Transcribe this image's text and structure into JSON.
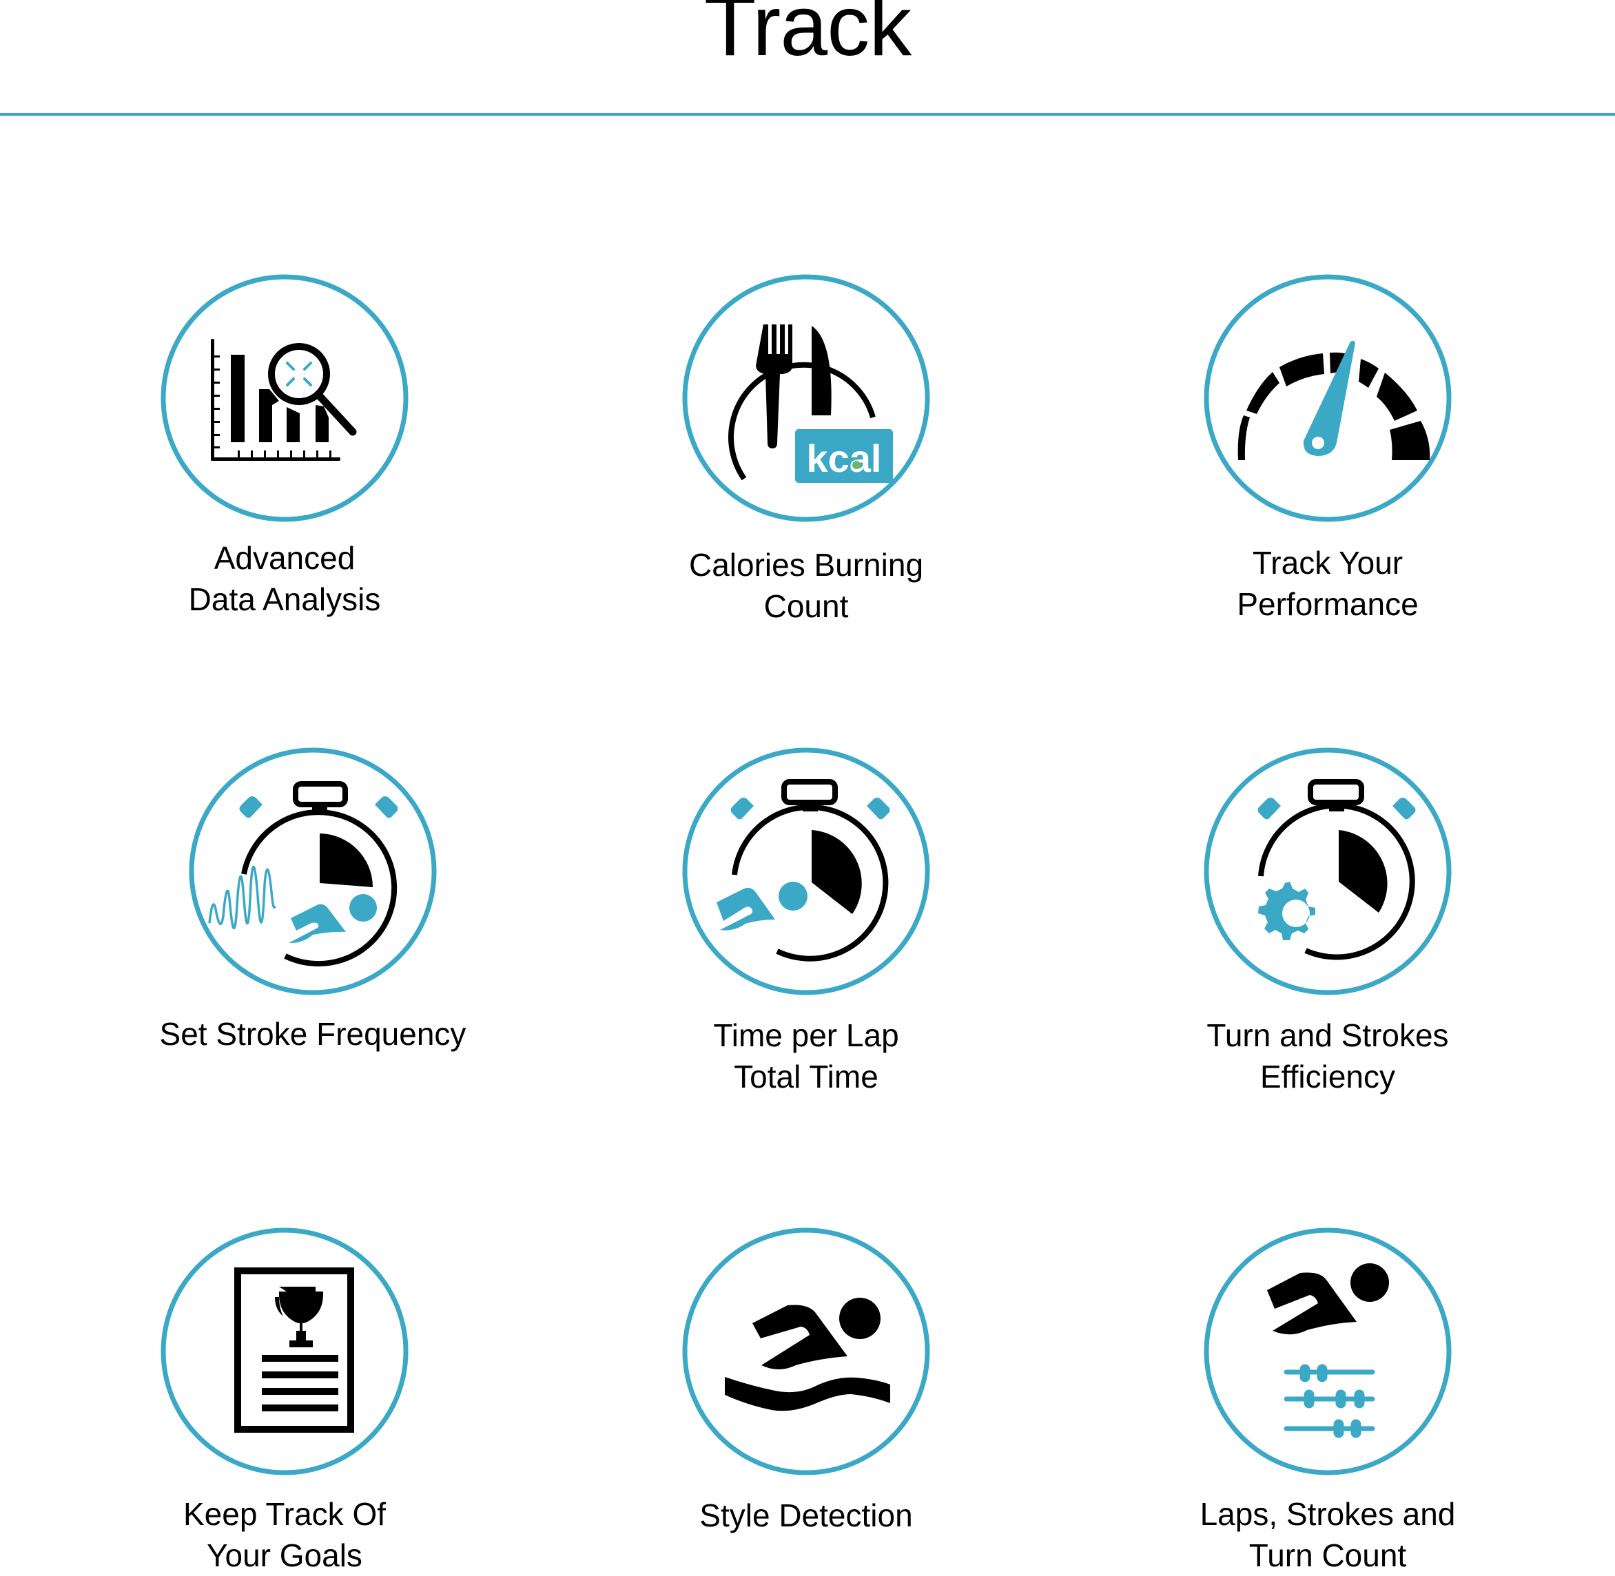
{
  "header": {
    "title": "Track"
  },
  "colors": {
    "accent": "#3ba8c5",
    "icon": "#000000",
    "kcal_dot": "#6cb86a"
  },
  "features": [
    {
      "icon": "data-analysis-icon",
      "label_lines": [
        "Advanced",
        "Data Analysis"
      ]
    },
    {
      "icon": "calories-icon",
      "badge": "kcal",
      "label_lines": [
        "Calories Burning",
        "Count"
      ]
    },
    {
      "icon": "speedometer-icon",
      "label_lines": [
        "Track Your",
        "Performance"
      ]
    },
    {
      "icon": "stroke-frequency-stopwatch-icon",
      "label_lines": [
        "Set Stroke Frequency"
      ]
    },
    {
      "icon": "lap-time-stopwatch-icon",
      "label_lines": [
        "Time per Lap",
        "Total Time"
      ]
    },
    {
      "icon": "efficiency-stopwatch-gear-icon",
      "label_lines": [
        "Turn and Strokes",
        "Efficiency"
      ]
    },
    {
      "icon": "goals-trophy-document-icon",
      "label_lines": [
        "Keep Track Of",
        "Your Goals"
      ]
    },
    {
      "icon": "swimmer-icon",
      "label_lines": [
        "Style Detection"
      ]
    },
    {
      "icon": "swimmer-counter-icon",
      "label_lines": [
        "Laps, Strokes and",
        "Turn Count"
      ]
    }
  ]
}
